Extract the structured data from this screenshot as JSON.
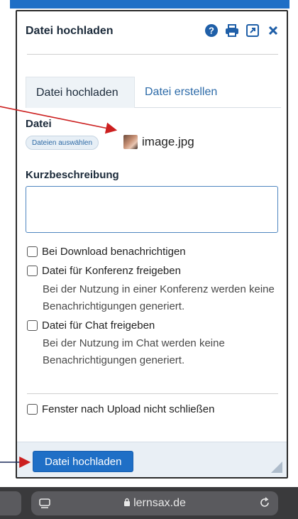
{
  "dialog": {
    "title": "Datei hochladen",
    "icons": [
      "help-icon",
      "print-icon",
      "open-external-icon",
      "close-icon"
    ]
  },
  "tabs": [
    {
      "label": "Datei hochladen",
      "active": true
    },
    {
      "label": "Datei erstellen",
      "active": false
    }
  ],
  "file": {
    "label": "Datei",
    "choose_button": "Dateien auswählen",
    "file_name": "image.jpg"
  },
  "description": {
    "label": "Kurzbeschreibung",
    "value": ""
  },
  "options": [
    {
      "label": "Bei Download benachrichtigen",
      "checked": false
    },
    {
      "label": "Datei für Konferenz freigeben",
      "checked": false,
      "note": "Bei der Nutzung in einer Konferenz werden keine Benachrichtigungen generiert."
    },
    {
      "label": "Datei für Chat freigeben",
      "checked": false,
      "note": "Bei der Nutzung im Chat werden keine Benachrichtigungen generiert."
    },
    {
      "label": "Fenster nach Upload nicht schließen",
      "checked": false
    }
  ],
  "footer": {
    "upload_button": "Datei hochladen"
  },
  "browser": {
    "url": "lernsax.de"
  },
  "colors": {
    "primary": "#1f6fc6",
    "annotation_arrow": "#cc1f1f"
  }
}
